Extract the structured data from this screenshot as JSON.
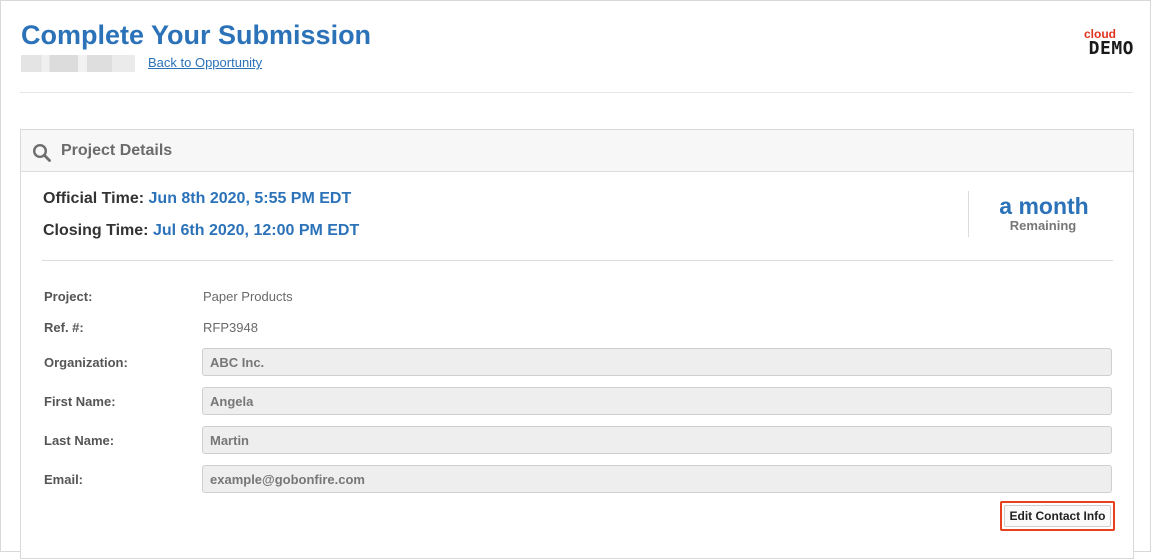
{
  "header": {
    "title": "Complete Your Submission",
    "back_link": "Back to Opportunity"
  },
  "logo": {
    "top_word": "cloud",
    "main_word": "DEMO",
    "accent_color": "#e2331c"
  },
  "panel": {
    "title": "Project Details",
    "icon": "search-icon",
    "official_time_label": "Official Time:",
    "official_time_value": "Jun 8th 2020, 5:55 PM EDT",
    "closing_time_label": "Closing Time:",
    "closing_time_value": "Jul 6th 2020, 12:00 PM EDT",
    "remaining_value": "a month",
    "remaining_label": "Remaining",
    "fields": {
      "project": {
        "label": "Project:",
        "value": "Paper Products"
      },
      "ref": {
        "label": "Ref. #:",
        "value": "RFP3948"
      },
      "organization": {
        "label": "Organization:",
        "value": "ABC Inc."
      },
      "first_name": {
        "label": "First Name:",
        "value": "Angela"
      },
      "last_name": {
        "label": "Last Name:",
        "value": "Martin"
      },
      "email": {
        "label": "Email:",
        "value": "example@gobonfire.com"
      }
    },
    "edit_button_label": "Edit Contact Info"
  },
  "colors": {
    "primary_blue": "#2b72b8",
    "highlight_red": "#e8401f"
  }
}
